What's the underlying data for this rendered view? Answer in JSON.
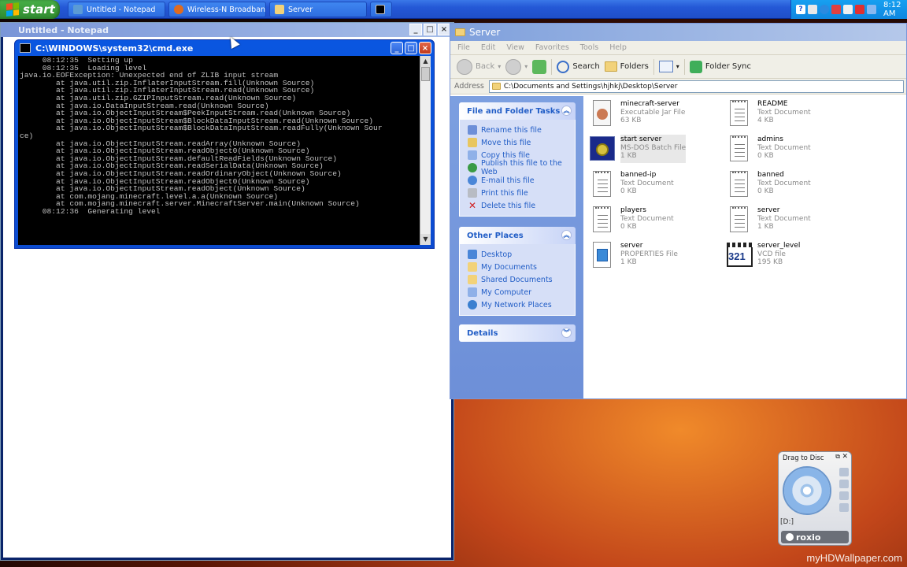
{
  "taskbar": {
    "start_label": "start",
    "buttons": [
      {
        "label": "Untitled - Notepad",
        "color": "#5b9bd5"
      },
      {
        "label": "Wireless-N Broadban...",
        "color": "#e06b1f"
      },
      {
        "label": "Server",
        "color": "#f2d27a"
      },
      {
        "label": "",
        "color": "#000000"
      }
    ],
    "clock": "8:12 AM"
  },
  "notepad": {
    "title": "Untitled - Notepad"
  },
  "cmd": {
    "title": "C:\\WINDOWS\\system32\\cmd.exe",
    "lines": [
      "     08:12:35  Setting up",
      "     08:12:35  Loading level",
      "java.io.EOFException: Unexpected end of ZLIB input stream",
      "        at java.util.zip.InflaterInputStream.fill(Unknown Source)",
      "        at java.util.zip.InflaterInputStream.read(Unknown Source)",
      "        at java.util.zip.GZIPInputStream.read(Unknown Source)",
      "        at java.io.DataInputStream.read(Unknown Source)",
      "        at java.io.ObjectInputStream$PeekInputStream.read(Unknown Source)",
      "        at java.io.ObjectInputStream$BlockDataInputStream.read(Unknown Source)",
      "        at java.io.ObjectInputStream$BlockDataInputStream.readFully(Unknown Sour",
      "ce)",
      "        at java.io.ObjectInputStream.readArray(Unknown Source)",
      "        at java.io.ObjectInputStream.readObject0(Unknown Source)",
      "        at java.io.ObjectInputStream.defaultReadFields(Unknown Source)",
      "        at java.io.ObjectInputStream.readSerialData(Unknown Source)",
      "        at java.io.ObjectInputStream.readOrdinaryObject(Unknown Source)",
      "        at java.io.ObjectInputStream.readObject0(Unknown Source)",
      "        at java.io.ObjectInputStream.readObject(Unknown Source)",
      "        at com.mojang.minecraft.level.a.a(Unknown Source)",
      "        at com.mojang.minecraft.server.MinecraftServer.main(Unknown Source)",
      "     08:12:36  Generating level"
    ]
  },
  "explorer": {
    "title": "Server",
    "menu": [
      "File",
      "Edit",
      "View",
      "Favorites",
      "Tools",
      "Help"
    ],
    "toolbar": {
      "back": "Back",
      "search": "Search",
      "folders": "Folders",
      "folder_sync": "Folder Sync"
    },
    "address": {
      "label": "Address",
      "path": "C:\\Documents and Settings\\hjhkj\\Desktop\\Server"
    },
    "file_tasks": {
      "title": "File and Folder Tasks",
      "items": [
        {
          "label": "Rename this file",
          "icon": "rename-icon"
        },
        {
          "label": "Move this file",
          "icon": "move-icon"
        },
        {
          "label": "Copy this file",
          "icon": "copy-icon"
        },
        {
          "label": "Publish this file to the Web",
          "icon": "globe-icon"
        },
        {
          "label": "E-mail this file",
          "icon": "email-icon"
        },
        {
          "label": "Print this file",
          "icon": "printer-icon"
        },
        {
          "label": "Delete this file",
          "icon": "delete-icon"
        }
      ]
    },
    "other_places": {
      "title": "Other Places",
      "items": [
        {
          "label": "Desktop",
          "icon": "desktop-icon"
        },
        {
          "label": "My Documents",
          "icon": "folder-icon"
        },
        {
          "label": "Shared Documents",
          "icon": "folder-icon"
        },
        {
          "label": "My Computer",
          "icon": "computer-icon"
        },
        {
          "label": "My Network Places",
          "icon": "network-icon"
        }
      ]
    },
    "details": {
      "title": "Details"
    },
    "files": [
      {
        "name": "minecraft-server",
        "type": "Executable Jar File",
        "size": "63 KB",
        "icon": "jar-icon"
      },
      {
        "name": "README",
        "type": "Text Document",
        "size": "4 KB",
        "icon": "text-document-icon"
      },
      {
        "name": "start server",
        "type": "MS-DOS Batch File",
        "size": "1 KB",
        "icon": "batch-file-icon"
      },
      {
        "name": "admins",
        "type": "Text Document",
        "size": "0 KB",
        "icon": "text-document-icon"
      },
      {
        "name": "banned-ip",
        "type": "Text Document",
        "size": "0 KB",
        "icon": "text-document-icon"
      },
      {
        "name": "banned",
        "type": "Text Document",
        "size": "0 KB",
        "icon": "text-document-icon"
      },
      {
        "name": "players",
        "type": "Text Document",
        "size": "0 KB",
        "icon": "text-document-icon"
      },
      {
        "name": "server",
        "type": "Text Document",
        "size": "1 KB",
        "icon": "text-document-icon"
      },
      {
        "name": "server",
        "type": "PROPERTIES File",
        "size": "1 KB",
        "icon": "properties-file-icon"
      },
      {
        "name": "server_level",
        "type": "VCD file",
        "size": "195 KB",
        "icon": "vcd-file-icon"
      }
    ]
  },
  "roxio": {
    "title": "Drag to Disc",
    "drive": "[D:]",
    "brand": "roxio"
  },
  "wallpaper_credit": "myHDWallpaper.com"
}
